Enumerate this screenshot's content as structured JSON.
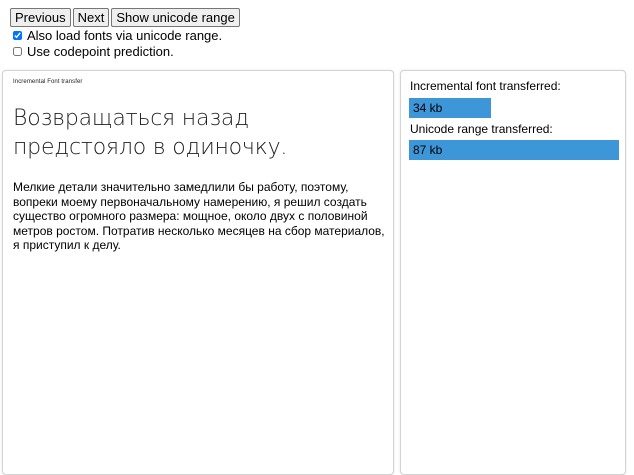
{
  "toolbar": {
    "previous_label": "Previous",
    "next_label": "Next",
    "show_unicode_label": "Show unicode range"
  },
  "options": {
    "load_unicode_label": "Also load fonts via unicode range.",
    "load_unicode_checked": true,
    "codepoint_label": "Use codepoint prediction.",
    "codepoint_checked": false
  },
  "left_panel": {
    "small_title": "Incremental Font transfer",
    "heading": "Возвращаться назад предстояло в одиночку.",
    "paragraph": "Мелкие детали значительно замедлили бы работу, поэтому, вопреки моему первоначальному намерению, я решил создать существо огромного размера: мощное, около двух с половиной метров ростом. Потратив несколько месяцев на сбор материалов, я приступил к делу."
  },
  "right_panel": {
    "incremental_label": "Incremental font transferred:",
    "incremental_value": "34 kb",
    "incremental_kb": 34,
    "unicode_label": "Unicode range transferred:",
    "unicode_value": "87 kb",
    "unicode_kb": 87,
    "bar_color": "#3d96d8"
  }
}
